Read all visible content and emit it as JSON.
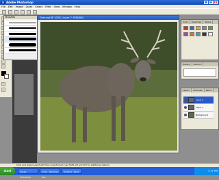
{
  "app": {
    "title": "Adobe Photoshop"
  },
  "menu": [
    "File",
    "Edit",
    "Image",
    "Layer",
    "Select",
    "Filter",
    "View",
    "Window",
    "Help"
  ],
  "brushes": {
    "title": "Brushes"
  },
  "document": {
    "title": "Deer.psd @ 100% (Layer 2, RGB/8#)"
  },
  "layers": {
    "tabs": [
      "Layers",
      "Channels",
      "Paths"
    ],
    "items": [
      "Layer 2",
      "Layer 1",
      "Background"
    ]
  },
  "panels": {
    "history_tabs": [
      "History",
      "Actions"
    ],
    "color_tabs": [
      "Color",
      "Swatches",
      "Styles"
    ]
  },
  "status": {
    "info": "Click and drag to paint with the current brush. Use Shift, Alt and Ctrl for additional options."
  },
  "taskbar": {
    "start": "start",
    "items": [
      "Adobe Photoshop",
      "Inbox - Windows Ma...",
      "Untitled - Paint"
    ],
    "clock": "7:37 PM"
  }
}
